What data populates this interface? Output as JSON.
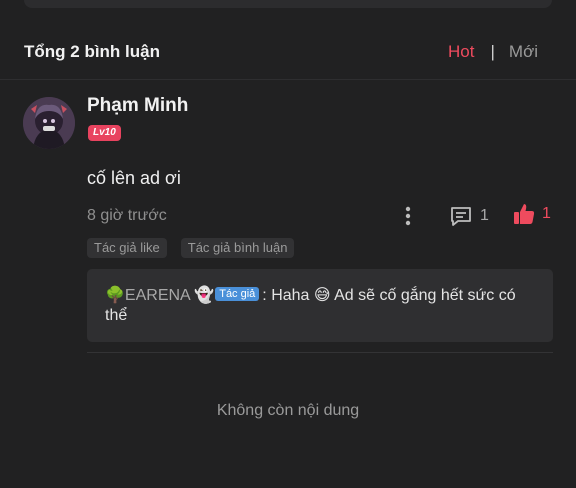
{
  "header": {
    "total_comments": "Tổng 2 bình luận",
    "sort_hot": "Hot",
    "sort_separator": "|",
    "sort_new": "Mới"
  },
  "comment": {
    "author": "Phạm Minh",
    "level": "Lv10",
    "text": "cố lên ad ơi",
    "time": "8 giờ trước",
    "reply_count": "1",
    "like_count": "1",
    "tags": [
      "Tác giả like",
      "Tác giả bình luận"
    ],
    "reply": {
      "author": "EARENA",
      "author_emoji_left": "🌳",
      "author_emoji_right": "👻",
      "badge": "Tác giả",
      "text": ": Haha 😅 Ad sẽ cố gắng hết sức có thể"
    }
  },
  "footer": {
    "end_text": "Không còn nội dung"
  },
  "colors": {
    "accent": "#ee4b5e",
    "background": "#212122",
    "badge_blue": "#4a90d9"
  },
  "icons": {
    "more": "more-vertical-icon",
    "reply": "comment-icon",
    "like": "thumbs-up-icon"
  }
}
